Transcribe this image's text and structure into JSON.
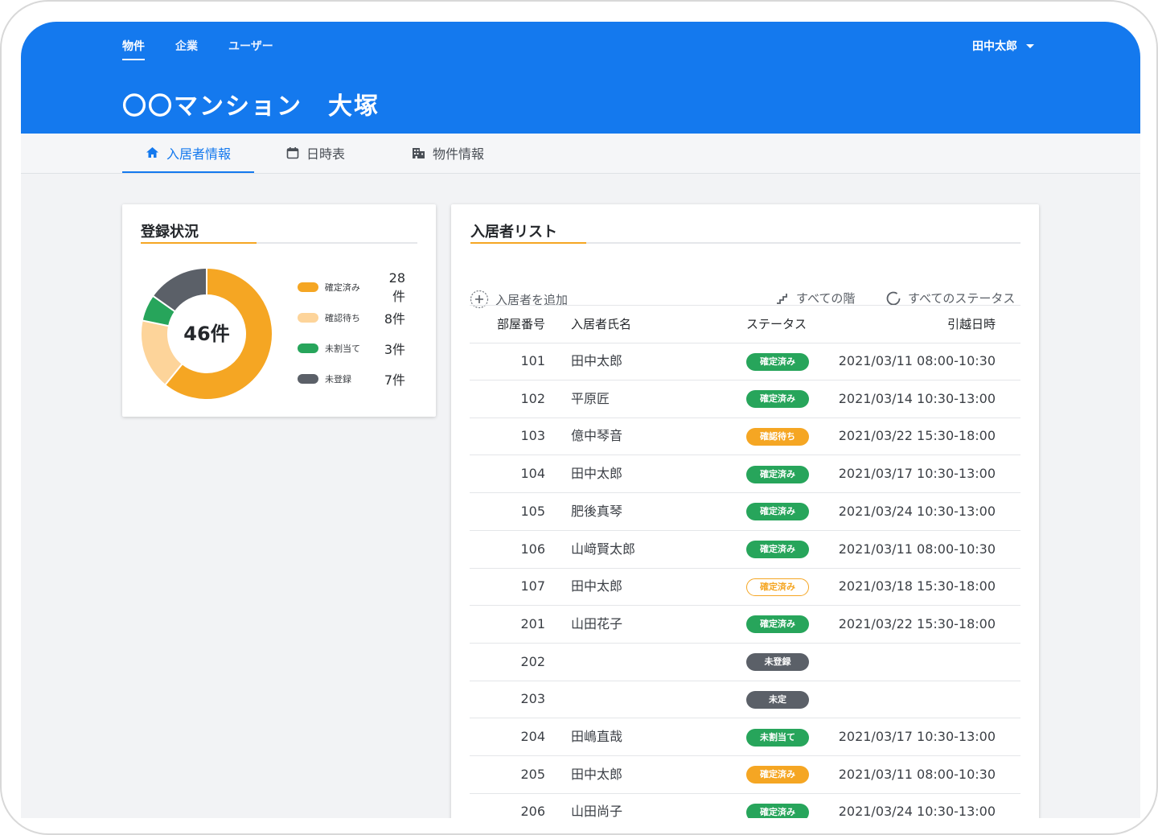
{
  "nav": {
    "items": [
      "物件",
      "企業",
      "ユーザー"
    ],
    "user": "田中太郎"
  },
  "page_title": "〇〇マンション　大塚",
  "tabs": [
    "入居者情報",
    "日時表",
    "物件情報"
  ],
  "registration": {
    "title": "登録状況",
    "total": "46件",
    "legend": [
      {
        "label": "確定済み",
        "count": "28件",
        "value": 28,
        "color": "#f5a623"
      },
      {
        "label": "確認待ち",
        "count": "8件",
        "value": 8,
        "color": "#fdd49a"
      },
      {
        "label": "未割当て",
        "count": "3件",
        "value": 3,
        "color": "#27a55b"
      },
      {
        "label": "未登録",
        "count": "7件",
        "value": 7,
        "color": "#5b6068"
      }
    ]
  },
  "residents": {
    "title": "入居者リスト",
    "add_label": "入居者を追加",
    "floor_filter": "すべての階",
    "status_filter": "すべてのステータス",
    "columns": [
      "部屋番号",
      "入居者氏名",
      "ステータス",
      "引越日時"
    ],
    "rows": [
      {
        "room": "101",
        "name": "田中太郎",
        "status": "確定済み",
        "style": "green",
        "date": "2021/03/11 08:00-10:30"
      },
      {
        "room": "102",
        "name": "平原匠",
        "status": "確定済み",
        "style": "green",
        "date": "2021/03/14 10:30-13:00"
      },
      {
        "room": "103",
        "name": "億中琴音",
        "status": "確認待ち",
        "style": "orange",
        "date": "2021/03/22 15:30-18:00"
      },
      {
        "room": "104",
        "name": "田中太郎",
        "status": "確定済み",
        "style": "green",
        "date": "2021/03/17 10:30-13:00"
      },
      {
        "room": "105",
        "name": "肥後真琴",
        "status": "確定済み",
        "style": "green",
        "date": "2021/03/24 10:30-13:00"
      },
      {
        "room": "106",
        "name": "山﨑賢太郎",
        "status": "確定済み",
        "style": "green",
        "date": "2021/03/11 08:00-10:30"
      },
      {
        "room": "107",
        "name": "田中太郎",
        "status": "確定済み",
        "style": "outline",
        "date": "2021/03/18 15:30-18:00"
      },
      {
        "room": "201",
        "name": "山田花子",
        "status": "確定済み",
        "style": "green",
        "date": "2021/03/22 15:30-18:00"
      },
      {
        "room": "202",
        "name": "",
        "status": "未登録",
        "style": "gray",
        "date": ""
      },
      {
        "room": "203",
        "name": "",
        "status": "未定",
        "style": "gray",
        "date": ""
      },
      {
        "room": "204",
        "name": "田嶋直哉",
        "status": "未割当て",
        "style": "green",
        "date": "2021/03/17 10:30-13:00"
      },
      {
        "room": "205",
        "name": "田中太郎",
        "status": "確定済み",
        "style": "orange",
        "date": "2021/03/11 08:00-10:30"
      },
      {
        "room": "206",
        "name": "山田尚子",
        "status": "確定済み",
        "style": "green",
        "date": "2021/03/24 10:30-13:00"
      }
    ]
  },
  "colors": {
    "primary": "#1479ee",
    "accent": "#f5a623",
    "green": "#27a55b",
    "gray": "#5b6068"
  }
}
